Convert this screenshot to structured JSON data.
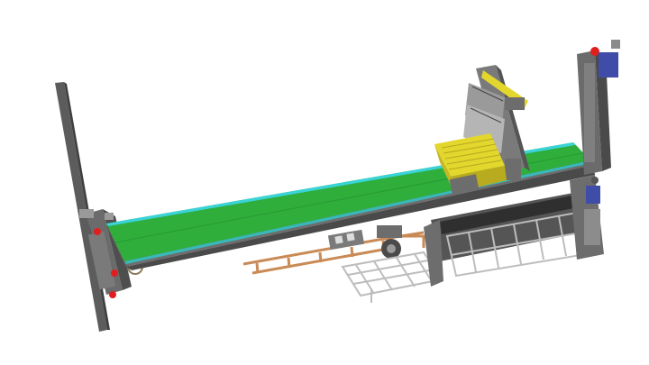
{
  "scene": {
    "view": "3d-cad-render",
    "subject": "conveyor-assembly",
    "background": "#ffffff"
  },
  "colors": {
    "belt": "#2fae3c",
    "belt_edge": "#39d3d8",
    "frame": "#6d6d6d",
    "frame_dark": "#4a4a4a",
    "yellow_part": "#e3d62d",
    "copper_rail": "#c98a55",
    "wire_basket": "#c8c8c8",
    "motor_blue": "#3f4da8",
    "red_sensor": "#e11e1e"
  },
  "watermark": {
    "text": "",
    "color": "#a9c4cf"
  }
}
